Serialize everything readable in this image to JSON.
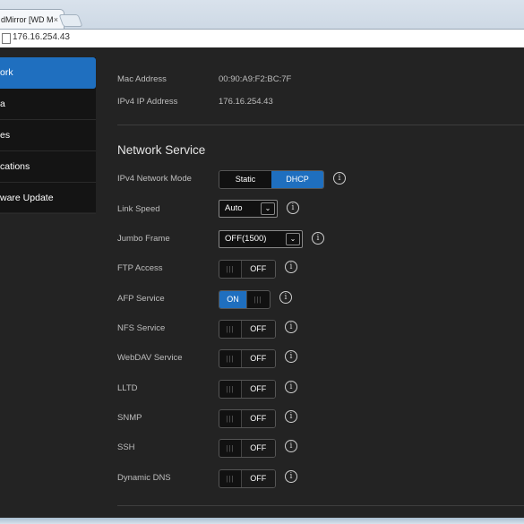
{
  "browser": {
    "tab_title": "dMirror [WD M",
    "tab_close": "×",
    "url": "176.16.254.43"
  },
  "sidebar": {
    "items": [
      {
        "label": "ork"
      },
      {
        "label": "a"
      },
      {
        "label": "es"
      },
      {
        "label": "cations"
      },
      {
        "label": "ware Update"
      }
    ]
  },
  "info_rows": {
    "mac_label": "Mac Address",
    "mac_value": "00:90:A9:F2:BC:7F",
    "ipv4_label": "IPv4 IP Address",
    "ipv4_value": "176.16.254.43"
  },
  "network_service": {
    "title": "Network Service",
    "ipv4_mode_label": "IPv4 Network Mode",
    "mode_static": "Static",
    "mode_dhcp": "DHCP",
    "mode_selected": "DHCP",
    "link_speed_label": "Link Speed",
    "link_speed_value": "Auto",
    "jumbo_label": "Jumbo Frame",
    "jumbo_value": "OFF(1500)",
    "services": [
      {
        "label": "FTP Access",
        "state": "OFF"
      },
      {
        "label": "AFP Service",
        "state": "ON"
      },
      {
        "label": "NFS Service",
        "state": "OFF"
      },
      {
        "label": "WebDAV Service",
        "state": "OFF"
      },
      {
        "label": "LLTD",
        "state": "OFF"
      },
      {
        "label": "SNMP",
        "state": "OFF"
      },
      {
        "label": "SSH",
        "state": "OFF"
      },
      {
        "label": "Dynamic DNS",
        "state": "OFF"
      }
    ]
  },
  "glyphs": {
    "info": "i",
    "chevron": "⌄",
    "grip": "|||"
  },
  "colors": {
    "accent": "#1f6fbf",
    "background": "#232323",
    "sidebar": "#141414"
  }
}
